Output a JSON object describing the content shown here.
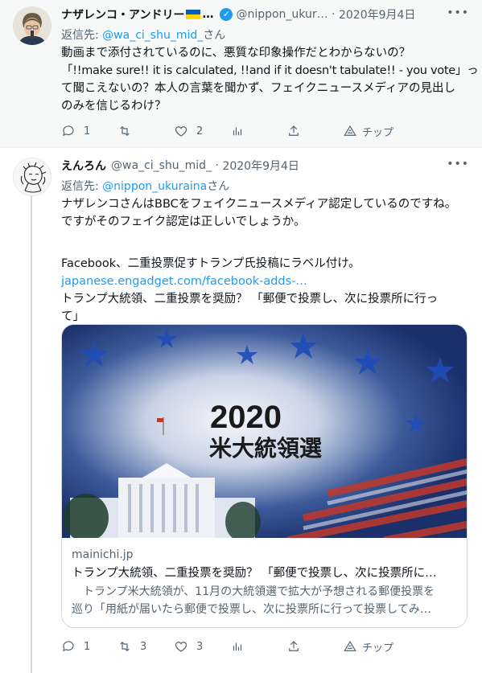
{
  "thread": [
    {
      "author": {
        "name": "ナザレンコ・アンドリー",
        "handle": "@nippon_ukur…",
        "date": "2020年9月4日"
      },
      "reply_to": {
        "prefix": "返信先: ",
        "mention": "@wa_ci_shu_mid_",
        "suffix": "さん"
      },
      "text_lines": [
        "動画まで添付されているのに、悪質な印象操作だとわからないの？",
        "「!!make sure!! it is calculated, !!and if it doesn't tabulate!! - you vote」っ",
        "て聞こえないの？本人の言葉を聞かず、フェイクニュースメディアの見出し",
        "のみを信じるわけ？"
      ],
      "actions": {
        "replies": "1",
        "retweets": "",
        "likes": "2",
        "tip": "チップ"
      }
    },
    {
      "author": {
        "name": "えんろん",
        "handle": "@wa_ci_shu_mid_",
        "date": "2020年9月4日"
      },
      "reply_to": {
        "prefix": "返信先: ",
        "mention": "@nippon_ukuraina",
        "suffix": "さん"
      },
      "text_lines": [
        "ナザレンコさんはBBCをフェイクニュースメディア認定しているのですね。",
        "ですがそのフェイク認定は正しいでしょうか。",
        "",
        "Facebook、二重投票促すトランプ氏投稿にラベル付け。"
      ],
      "link": "japanese.engadget.com/facebook-adds-…",
      "text_after_link": [
        "トランプ大統領、二重投票を奨励？ 「郵便で投票し、次に投票所に行っ",
        "て」"
      ],
      "card": {
        "image_title_year": "2020",
        "image_title_text": "米大統領選",
        "domain": "mainichi.jp",
        "title": "トランプ大統領、二重投票を奨励？ 「郵便で投票し、次に投票所に…",
        "desc_lines": [
          "　トランプ米大統領が、11月の大統領選で拡大が予想される郵便投票を",
          "巡り「用紙が届いたら郵便で投票し、次に投票所に行って投票してみ…"
        ]
      },
      "actions": {
        "replies": "1",
        "retweets": "3",
        "likes": "3",
        "tip": "チップ"
      }
    }
  ],
  "icons": {
    "more": "more-icon",
    "reply": "reply-icon",
    "retweet": "retweet-icon",
    "like": "heart-icon",
    "views": "analytics-icon",
    "share": "share-icon",
    "tip": "tip-icon",
    "verified": "verified-badge-icon"
  },
  "colors": {
    "accent": "#1d9bf0",
    "secondary_text": "#536471",
    "flag_blue": "#005bbb",
    "flag_yellow": "#ffd500"
  }
}
